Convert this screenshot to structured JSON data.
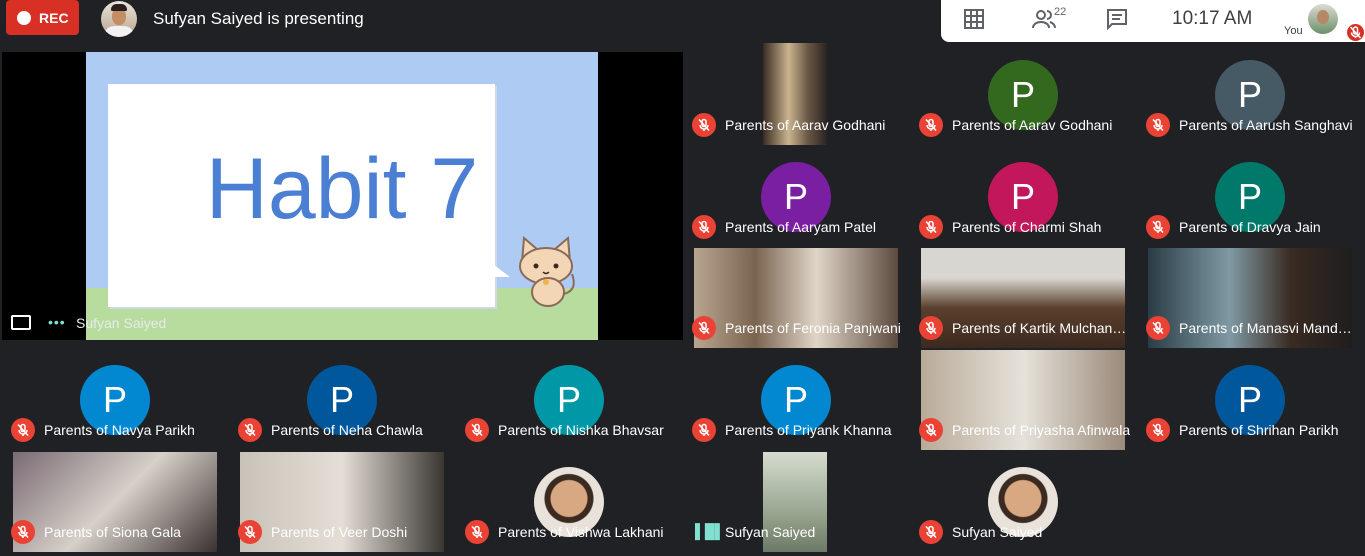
{
  "header": {
    "rec_label": "REC",
    "presenting_text": "Sufyan Saiyed is presenting",
    "people_count": "22",
    "time": "10:17  AM",
    "you_label": "You"
  },
  "presentation": {
    "slide_title": "Habit 7",
    "presenter_name": "Sufyan Saiyed"
  },
  "tiles": [
    {
      "name": "Parents of Aarav Godhani",
      "type": "video"
    },
    {
      "name": "Parents of Aarav Godhani",
      "type": "letter",
      "letter": "P",
      "color": "#33691e"
    },
    {
      "name": "Parents of Aarush Sanghavi",
      "type": "letter",
      "letter": "P",
      "color": "#455a64"
    },
    {
      "name": "Parents of Aaryam Patel",
      "type": "letter",
      "letter": "P",
      "color": "#7b1fa2"
    },
    {
      "name": "Parents of Charmi Shah",
      "type": "letter",
      "letter": "P",
      "color": "#c2185b"
    },
    {
      "name": "Parents of Dravya Jain",
      "type": "letter",
      "letter": "P",
      "color": "#00796b"
    },
    {
      "name": "Parents of Feronia Panjwani",
      "type": "video"
    },
    {
      "name": "Parents of Kartik Mulchand…",
      "type": "video"
    },
    {
      "name": "Parents of Manasvi Mandha…",
      "type": "video"
    },
    {
      "name": "Parents of Priyank Khanna",
      "type": "letter",
      "letter": "P",
      "color": "#0288d1"
    },
    {
      "name": "Parents of Priyasha Afinwala",
      "type": "video"
    },
    {
      "name": "Parents of Shrihan Parikh",
      "type": "letter",
      "letter": "P",
      "color": "#01579b"
    },
    {
      "name": "Parents of Navya Parikh",
      "type": "letter",
      "letter": "P",
      "color": "#0288d1"
    },
    {
      "name": "Parents of Neha Chawla",
      "type": "letter",
      "letter": "P",
      "color": "#01579b"
    },
    {
      "name": "Parents of Nishka Bhavsar",
      "type": "letter",
      "letter": "P",
      "color": "#0097a7"
    },
    {
      "name": "Parents of Siona Gala",
      "type": "video"
    },
    {
      "name": "Parents of Veer Doshi",
      "type": "video"
    },
    {
      "name": "Parents of Vishwa Lakhani",
      "type": "photo"
    },
    {
      "name": "Sufyan Saiyed",
      "type": "video",
      "speaking": true
    },
    {
      "name": "Sufyan Saiyed",
      "type": "photo"
    }
  ],
  "colors": {
    "background": "#202124",
    "rec_red": "#d93025",
    "mic_red": "#ea4335",
    "speaking_teal": "#81e0d0"
  }
}
